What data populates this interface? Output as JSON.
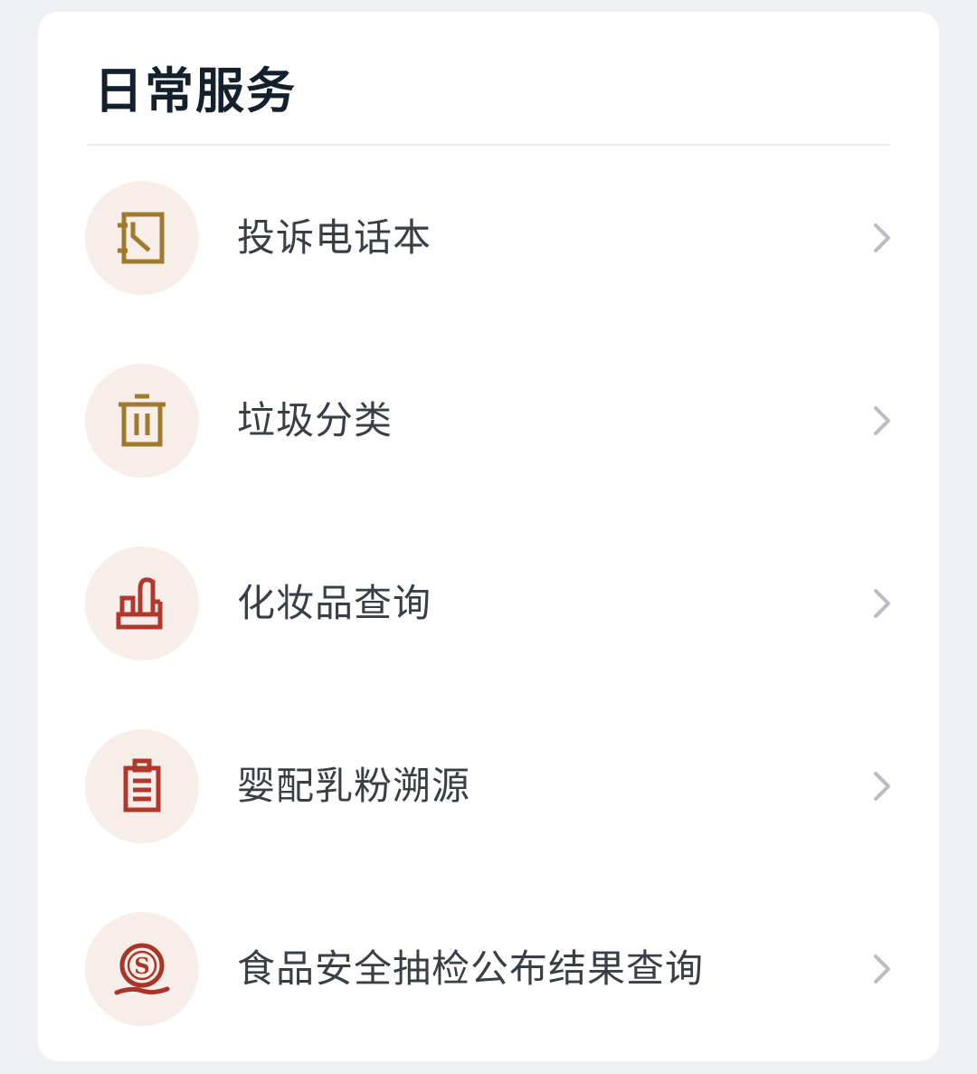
{
  "card": {
    "title": "日常服务"
  },
  "items": [
    {
      "label": "投诉电话本",
      "icon": "phone-book-icon",
      "color": "#a07a2c"
    },
    {
      "label": "垃圾分类",
      "icon": "trash-bin-icon",
      "color": "#a07a2c"
    },
    {
      "label": "化妆品查询",
      "icon": "lipstick-icon",
      "color": "#b0382c"
    },
    {
      "label": "婴配乳粉溯源",
      "icon": "clipboard-icon",
      "color": "#b0382c"
    },
    {
      "label": "食品安全抽检公布结果查询",
      "icon": "s-seal-icon",
      "color": "#a8352a"
    }
  ],
  "colors": {
    "background": "#eef0f4",
    "card": "#ffffff",
    "icon_circle": "#f7eeea",
    "gold": "#a07a2c",
    "red": "#b0382c",
    "chevron": "#b9bcc2"
  }
}
